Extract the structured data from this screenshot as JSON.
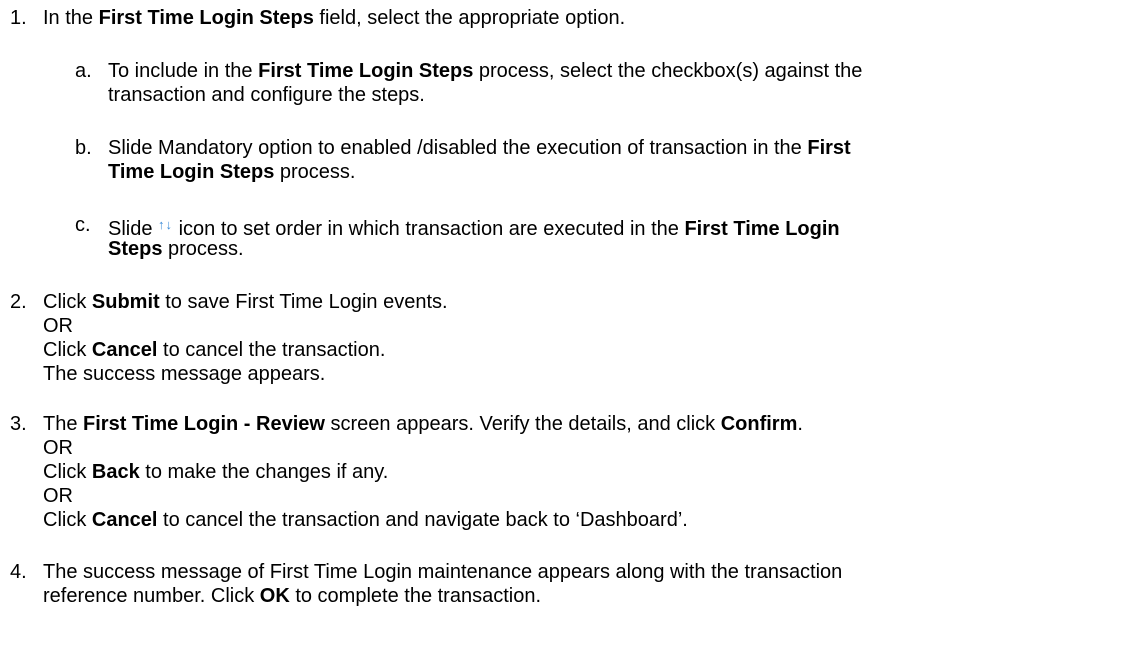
{
  "steps": {
    "s1": {
      "num": "1.",
      "pre": "In the ",
      "b1": "First Time Login Steps",
      "post": " field, select the appropriate option.",
      "a": {
        "label": "a.",
        "l1_pre": "To include in the ",
        "l1_b": "First Time Login Steps",
        "l1_post": " process, select the checkbox(s) against the",
        "l2": "transaction and configure the steps."
      },
      "b": {
        "label": "b.",
        "l1_pre": "Slide Mandatory option to enabled /disabled the execution of transaction in the ",
        "l1_b": "First",
        "l2_b": "Time Login Steps",
        "l2_post": " process."
      },
      "c": {
        "label": "c.",
        "l1_pre": "Slide ",
        "icon": "sort-arrows-icon",
        "icon_glyph": "↑↓",
        "l1_mid": " icon to set order in which transaction are executed in the ",
        "l1_b": "First Time Login",
        "l2_b": "Steps",
        "l2_post": " process."
      }
    },
    "s2": {
      "num": "2.",
      "l1_pre": "Click ",
      "l1_b": "Submit",
      "l1_post": " to save First Time Login events.",
      "l2": "OR",
      "l3_pre": "Click ",
      "l3_b": "Cancel",
      "l3_post": " to cancel the transaction.",
      "l4": "The success message appears."
    },
    "s3": {
      "num": "3.",
      "l1_pre": "The ",
      "l1_b": "First Time Login - Review",
      "l1_mid": " screen appears. Verify the details, and click ",
      "l1_b2": "Confirm",
      "l1_post": ".",
      "l2": "OR",
      "l3_pre": "Click ",
      "l3_b": "Back",
      "l3_post": " to make the changes if any.",
      "l4": "OR",
      "l5_pre": "Click ",
      "l5_b": "Cancel",
      "l5_post": " to cancel the transaction and navigate back to ‘Dashboard’."
    },
    "s4": {
      "num": "4.",
      "l1": "The success message of First Time Login maintenance appears along with the transaction",
      "l2_pre": "reference number. Click ",
      "l2_b": "OK",
      "l2_post": " to complete the transaction."
    }
  }
}
